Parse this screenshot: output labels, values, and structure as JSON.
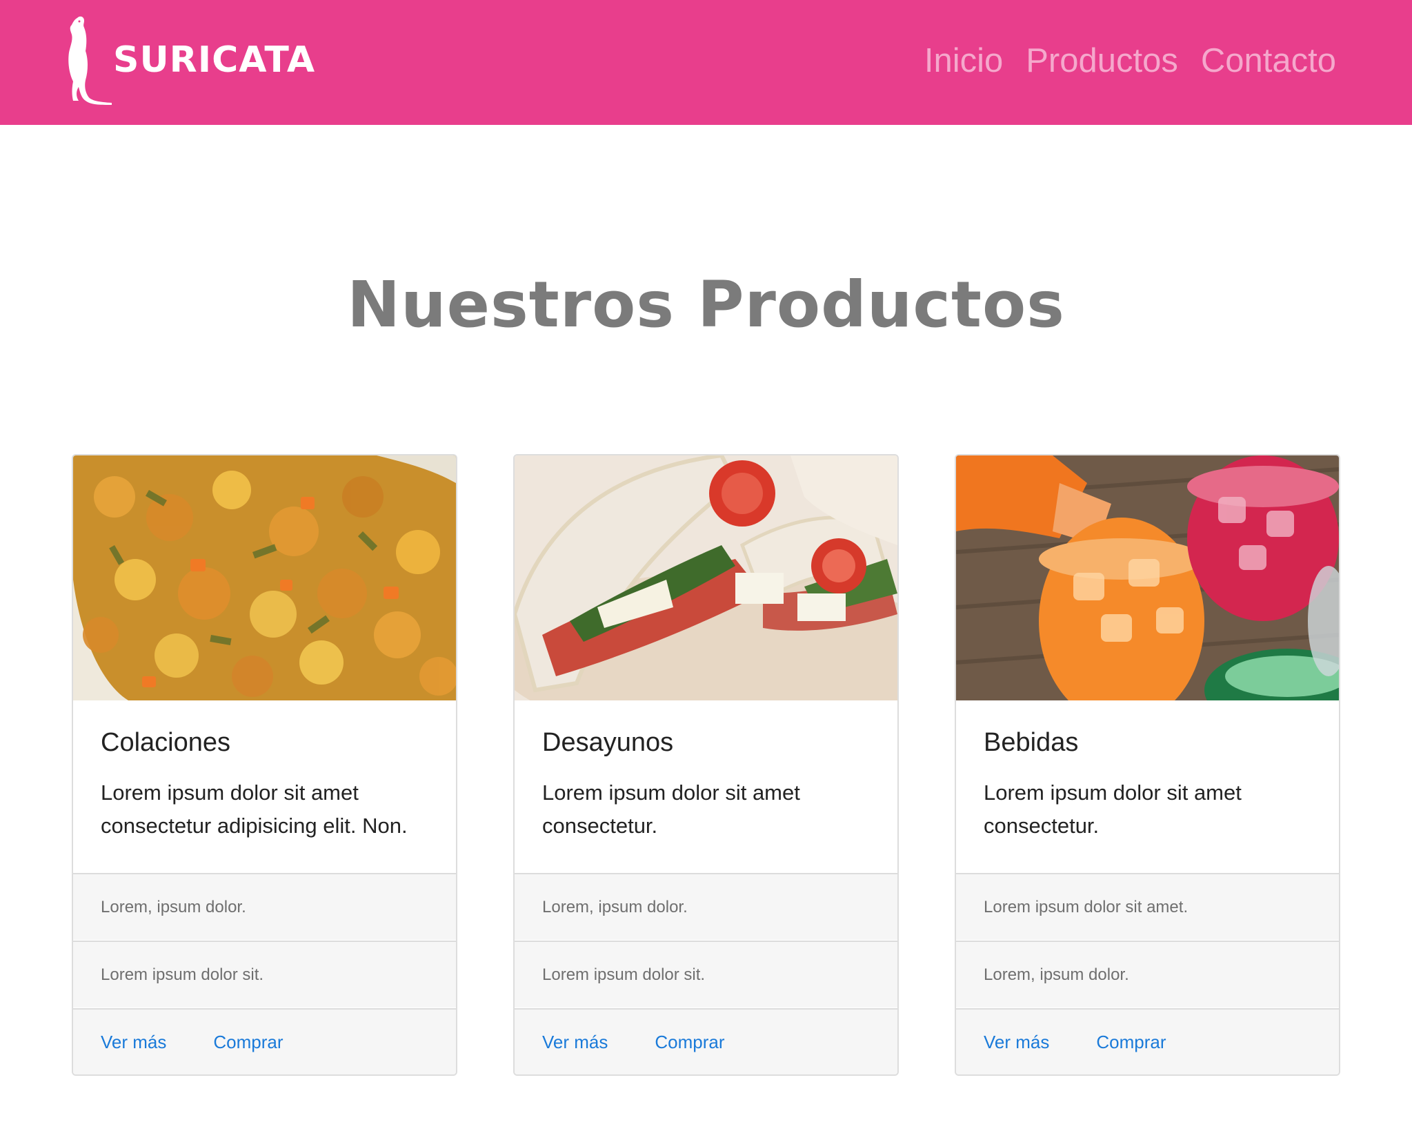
{
  "brand": {
    "name": "SURICATA",
    "logo_icon": "meerkat-icon"
  },
  "nav": {
    "items": [
      "Inicio",
      "Productos",
      "Contacto"
    ]
  },
  "page": {
    "title": "Nuestros Productos"
  },
  "cards": [
    {
      "image": "food-image-colaciones",
      "title": "Colaciones",
      "text": "Lorem ipsum dolor sit amet consectetur adipisicing elit. Non.",
      "list": [
        "Lorem, ipsum dolor.",
        "Lorem ipsum dolor sit."
      ],
      "links": [
        "Ver más",
        "Comprar"
      ]
    },
    {
      "image": "food-image-desayunos",
      "title": "Desayunos",
      "text": "Lorem ipsum dolor sit amet consectetur.",
      "list": [
        "Lorem, ipsum dolor.",
        "Lorem ipsum dolor sit."
      ],
      "links": [
        "Ver más",
        "Comprar"
      ]
    },
    {
      "image": "food-image-bebidas",
      "title": "Bebidas",
      "text": "Lorem ipsum dolor sit amet consectetur.",
      "list": [
        "Lorem ipsum dolor sit amet.",
        "Lorem, ipsum dolor."
      ],
      "links": [
        "Ver más",
        "Comprar"
      ]
    }
  ],
  "colors": {
    "navbar": "#e83e8c",
    "nav_link": "#f5a8cc",
    "title": "#7b7b7b",
    "link": "#1a7ad9"
  }
}
